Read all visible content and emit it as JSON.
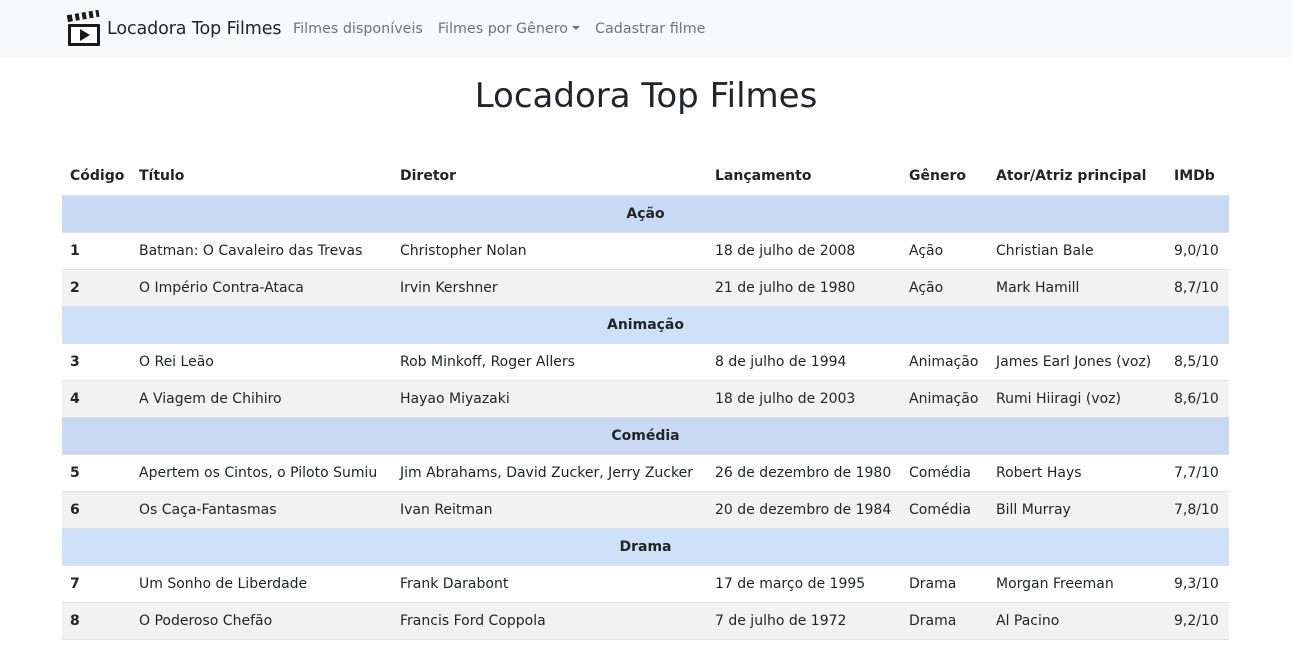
{
  "navbar": {
    "brand": "Locadora Top Filmes",
    "links": [
      "Filmes disponíveis",
      "Filmes por Gênero",
      "Cadastrar filme"
    ]
  },
  "page": {
    "title": "Locadora Top Filmes"
  },
  "table": {
    "headers": [
      "Código",
      "Título",
      "Diretor",
      "Lançamento",
      "Gênero",
      "Ator/Atriz principal",
      "IMDb"
    ],
    "groups": [
      {
        "genre": "Ação",
        "rows": [
          [
            "1",
            "Batman: O Cavaleiro das Trevas",
            "Christopher Nolan",
            "18 de julho de 2008",
            "Ação",
            "Christian Bale",
            "9,0/10"
          ],
          [
            "2",
            "O Império Contra-Ataca",
            "Irvin Kershner",
            "21 de julho de 1980",
            "Ação",
            "Mark Hamill",
            "8,7/10"
          ]
        ]
      },
      {
        "genre": "Animação",
        "rows": [
          [
            "3",
            "O Rei Leão",
            "Rob Minkoff, Roger Allers",
            "8 de julho de 1994",
            "Animação",
            "James Earl Jones (voz)",
            "8,5/10"
          ],
          [
            "4",
            "A Viagem de Chihiro",
            "Hayao Miyazaki",
            "18 de julho de 2003",
            "Animação",
            "Rumi Hiiragi (voz)",
            "8,6/10"
          ]
        ]
      },
      {
        "genre": "Comédia",
        "rows": [
          [
            "5",
            "Apertem os Cintos, o Piloto Sumiu",
            "Jim Abrahams, David Zucker, Jerry Zucker",
            "26 de dezembro de 1980",
            "Comédia",
            "Robert Hays",
            "7,7/10"
          ],
          [
            "6",
            "Os Caça-Fantasmas",
            "Ivan Reitman",
            "20 de dezembro de 1984",
            "Comédia",
            "Bill Murray",
            "7,8/10"
          ]
        ]
      },
      {
        "genre": "Drama",
        "rows": [
          [
            "7",
            "Um Sonho de Liberdade",
            "Frank Darabont",
            "17 de março de 1995",
            "Drama",
            "Morgan Freeman",
            "9,3/10"
          ],
          [
            "8",
            "O Poderoso Chefão",
            "Francis Ford Coppola",
            "7 de julho de 1972",
            "Drama",
            "Al Pacino",
            "9,2/10"
          ]
        ]
      }
    ]
  },
  "colors": {
    "navbar_bg": "#f8f9fa",
    "genre_row_bg": "#c9d8f3",
    "genre_row_bg_alt": "#cfe0f9",
    "striped_row_bg": "#f2f2f2"
  },
  "icons": {
    "brand": "clapperboard-play-icon",
    "dropdown": "caret-down-icon"
  }
}
